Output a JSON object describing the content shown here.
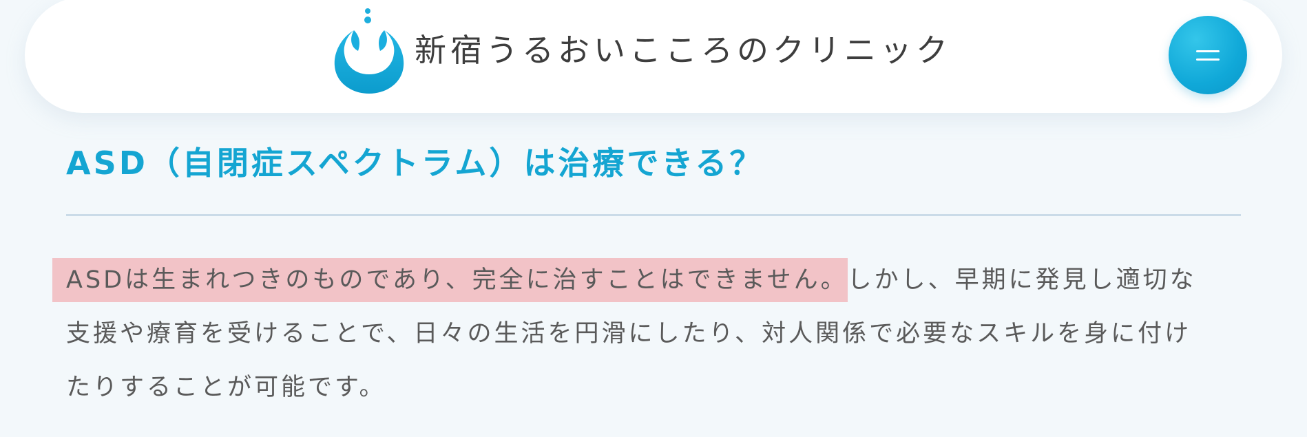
{
  "header": {
    "logo_text": "新宿うるおいこころのクリニック",
    "logo_icon": "water-drop-logo",
    "menu_icon": "hamburger-menu-icon",
    "accent_color": "#14a5d2"
  },
  "article": {
    "heading": "ASD（自閉症スペクトラム）は治療できる？",
    "highlighted_sentence": "ASDは生まれつきのものであり、完全に治すことはできません。",
    "line1_rest": "しかし、早期に発見し適切な",
    "line2": "支援や療育を受けることで、日々の生活を円滑にしたり、対人関係で必要なスキルを身に付け",
    "line3": "たりすることが可能です。",
    "highlight_color": "#f2c3c7"
  }
}
